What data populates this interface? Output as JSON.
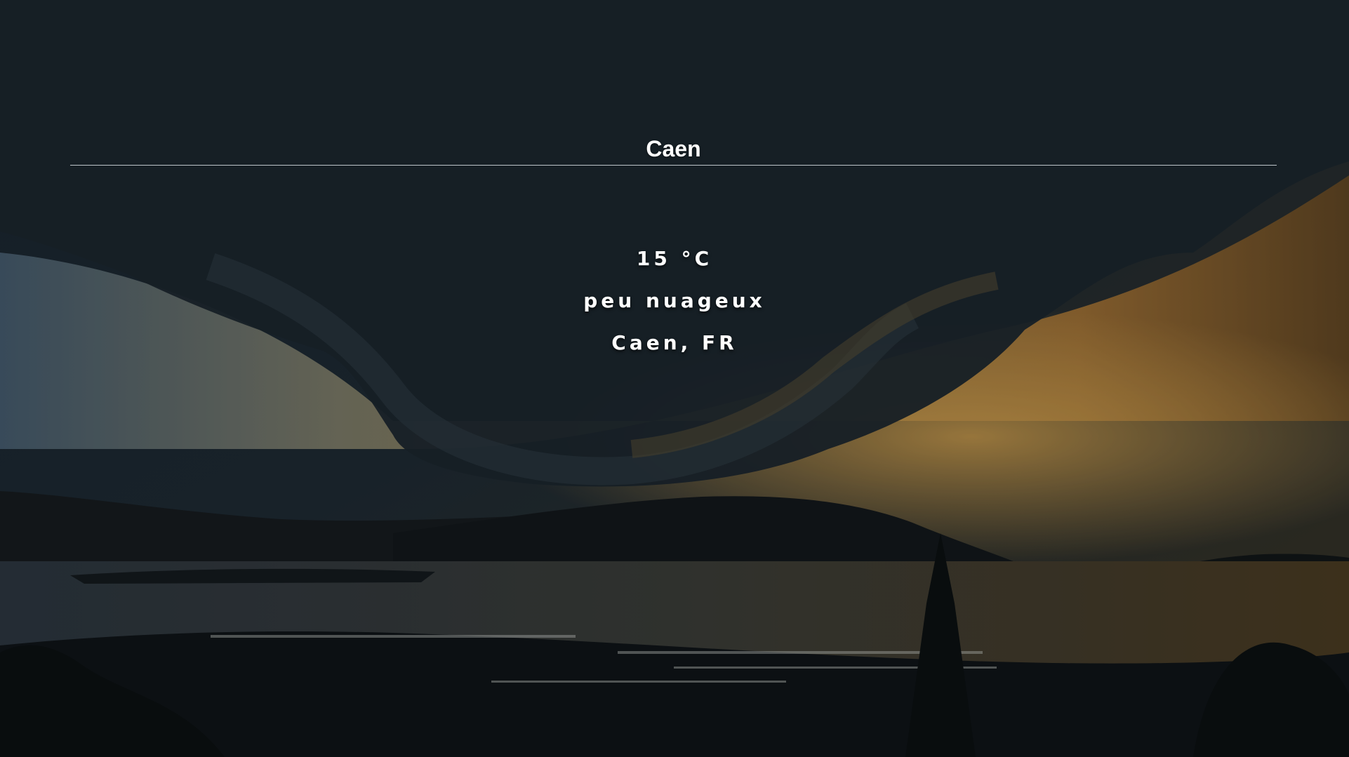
{
  "search": {
    "value": "Caen"
  },
  "weather": {
    "temperature": "15 °C",
    "description": "peu nuageux",
    "location": "Caen, FR"
  },
  "background": {
    "icon": "storm-landscape-photo"
  }
}
